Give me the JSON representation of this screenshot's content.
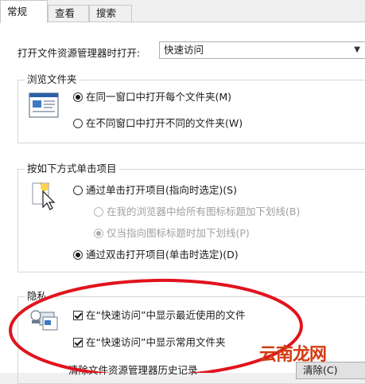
{
  "tabs": [
    {
      "label": "常规",
      "active": true
    },
    {
      "label": "查看",
      "active": false
    },
    {
      "label": "搜索",
      "active": false
    }
  ],
  "open_explorer": {
    "label": "打开文件资源管理器时打开:",
    "selected": "快速访问"
  },
  "browse_folders": {
    "title": "浏览文件夹",
    "options": [
      {
        "label": "在同一窗口中打开每个文件夹(M)",
        "checked": true
      },
      {
        "label": "在不同窗口中打开不同的文件夹(W)",
        "checked": false
      }
    ]
  },
  "click_items": {
    "title": "按如下方式单击项目",
    "single_click": "通过单击打开项目(指向时选定)(S)",
    "underline_all": "在我的浏览器中给所有图标标题加下划线(B)",
    "underline_hover": "仅当指向图标标题时加下划线(P)",
    "double_click": "通过双击打开项目(单击时选定)(D)"
  },
  "privacy": {
    "title": "隐私",
    "show_recent_files": "在“快速访问”中显示最近使用的文件",
    "show_frequent_folders": "在“快速访问”中显示常用文件夹",
    "clear_history_label": "清除文件资源管理器历史记录",
    "clear_button": "清除(C)"
  },
  "watermark": "云南龙网",
  "colors": {
    "annotation": "#e0141e",
    "watermark": "#d43a12"
  }
}
